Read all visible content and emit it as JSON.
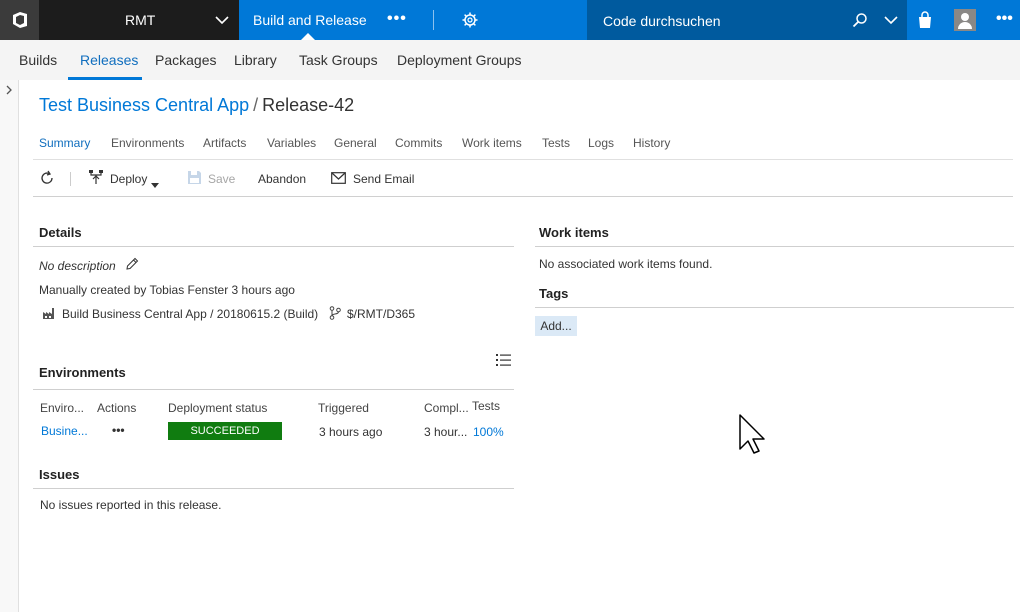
{
  "topbar": {
    "project": "RMT",
    "hub": "Build and Release",
    "more": "•••",
    "search_placeholder": "Code durchsuchen",
    "more2": "•••"
  },
  "subnav": {
    "items": [
      "Builds",
      "Releases",
      "Packages",
      "Library",
      "Task Groups",
      "Deployment Groups"
    ],
    "active": "Releases"
  },
  "breadcrumb": {
    "definition": "Test Business Central App",
    "separator": "/",
    "release": "Release-42"
  },
  "tabs": [
    "Summary",
    "Environments",
    "Artifacts",
    "Variables",
    "General",
    "Commits",
    "Work items",
    "Tests",
    "Logs",
    "History"
  ],
  "toolbar": {
    "deploy": "Deploy",
    "save": "Save",
    "abandon": "Abandon",
    "send_email": "Send Email"
  },
  "details": {
    "heading": "Details",
    "description": "No description",
    "created": "Manually created by Tobias Fenster 3 hours ago",
    "artifact": "Build Business Central App / 20180615.2 (Build)",
    "branch": "$/RMT/D365"
  },
  "environments": {
    "heading": "Environments",
    "columns": [
      "Enviro...",
      "Actions",
      "Deployment status",
      "Triggered",
      "Compl...",
      "Tests"
    ],
    "rows": [
      {
        "name": "Busine...",
        "actions": "•••",
        "status": "SUCCEEDED",
        "triggered": "3 hours ago",
        "completed": "3 hour...",
        "tests": "100%"
      }
    ]
  },
  "issues": {
    "heading": "Issues",
    "text": "No issues reported in this release."
  },
  "work_items": {
    "heading": "Work items",
    "text": "No associated work items found."
  },
  "tags": {
    "heading": "Tags",
    "add": "Add..."
  },
  "colors": {
    "accent": "#0078d7",
    "topbar": "#0078d7",
    "project_bg": "#1c1c1c",
    "search_bg": "#005a9e",
    "success": "#107c10",
    "tag_bg": "#dbe9f6"
  }
}
